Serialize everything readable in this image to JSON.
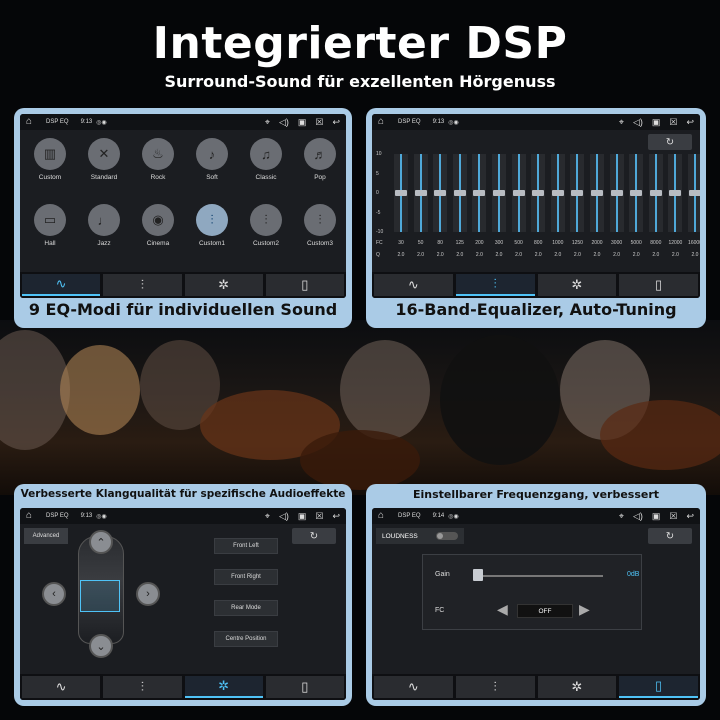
{
  "hero": {
    "title": "Integrierter DSP",
    "subtitle": "Surround-Sound für exzellenten Hörgenuss"
  },
  "status": {
    "app_title": "DSP EQ",
    "time_a": "9:13",
    "time_b": "9:14"
  },
  "tabs": [
    "waveform-icon",
    "sliders-icon",
    "surround-icon",
    "speaker-icon"
  ],
  "panel1": {
    "caption": "9 EQ-Modi für individuellen Sound",
    "presets": [
      "Custom",
      "Standard",
      "Rock",
      "Soft",
      "Classic",
      "Pop",
      "Hall",
      "Jazz",
      "Cinema",
      "Custom1",
      "Custom2",
      "Custom3"
    ],
    "active_preset": "Custom1"
  },
  "panel2": {
    "caption": "16-Band-Equalizer, Auto-Tuning",
    "y_labels": [
      "10",
      "5",
      "0",
      "-5",
      "-10"
    ],
    "fc_label": "FC",
    "q_label": "Q",
    "frequencies": [
      "30",
      "50",
      "80",
      "125",
      "200",
      "300",
      "500",
      "800",
      "1000",
      "1250",
      "2000",
      "3000",
      "5000",
      "8000",
      "12000",
      "16000"
    ],
    "q_values": [
      "2.0",
      "2.0",
      "2.0",
      "2.0",
      "2.0",
      "2.0",
      "2.0",
      "2.0",
      "2.0",
      "2.0",
      "2.0",
      "2.0",
      "2.0",
      "2.0",
      "2.0",
      "2.0"
    ],
    "band_gains": [
      0,
      0,
      0,
      0,
      0,
      0,
      0,
      0,
      0,
      0,
      0,
      0,
      0,
      0,
      0,
      0
    ]
  },
  "panel3": {
    "caption": "Verbesserte Klangqualität für spezifische Audioeffekte",
    "advanced": "Advanced",
    "buttons": [
      "Front Left",
      "Front Right",
      "Rear Mode",
      "Centre Position"
    ]
  },
  "panel4": {
    "caption": "Einstellbarer Frequenzgang, verbessert",
    "loudness": "LOUDNESS",
    "gain_label": "Gain",
    "gain_value": "0dB",
    "fc_label": "FC",
    "fc_value": "OFF"
  },
  "colors": {
    "accent": "#4fc3f7",
    "panel_frame": "#aacbe6"
  }
}
